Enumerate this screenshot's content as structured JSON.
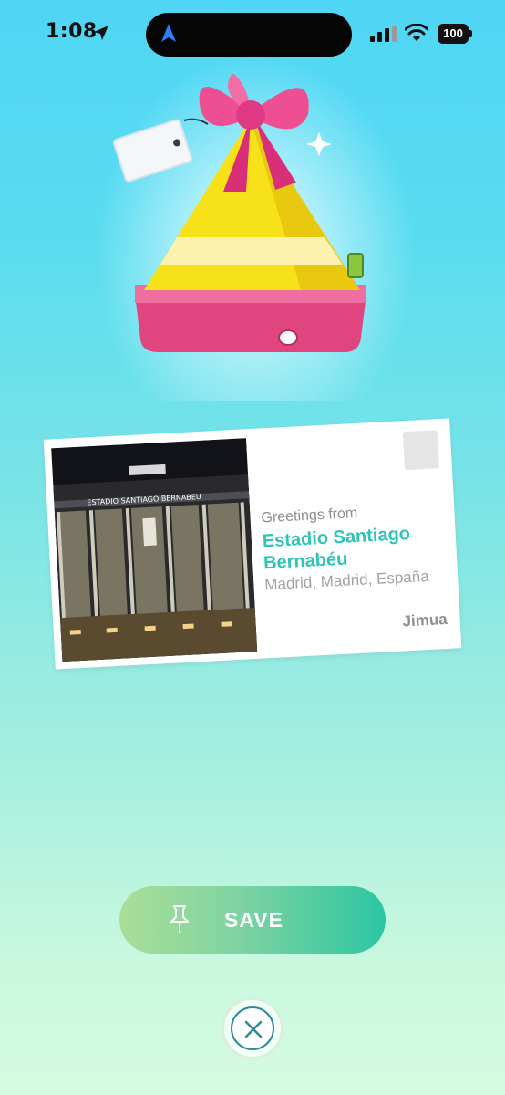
{
  "status_bar": {
    "time": "1:08",
    "battery": "100"
  },
  "postcard": {
    "greeting": "Greetings from",
    "place_name": "Estadio Santiago Bernabéu",
    "locality": "Madrid, Madrid, España",
    "sender": "Jimua",
    "photo_sign": "ESTADIO SANTIAGO BERNABEU"
  },
  "actions": {
    "save_label": "SAVE"
  },
  "icons": {
    "location": "location-arrow-icon",
    "navigation": "navigation-arrow-icon",
    "signal": "cellular-signal-icon",
    "wifi": "wifi-icon",
    "battery": "battery-icon",
    "pin": "pin-icon",
    "close": "close-icon"
  },
  "colors": {
    "place_name": "#2ec4b8",
    "save_gradient_start": "#a9df96",
    "save_gradient_end": "#2cc6a2",
    "close_ring": "#2d8a96"
  }
}
